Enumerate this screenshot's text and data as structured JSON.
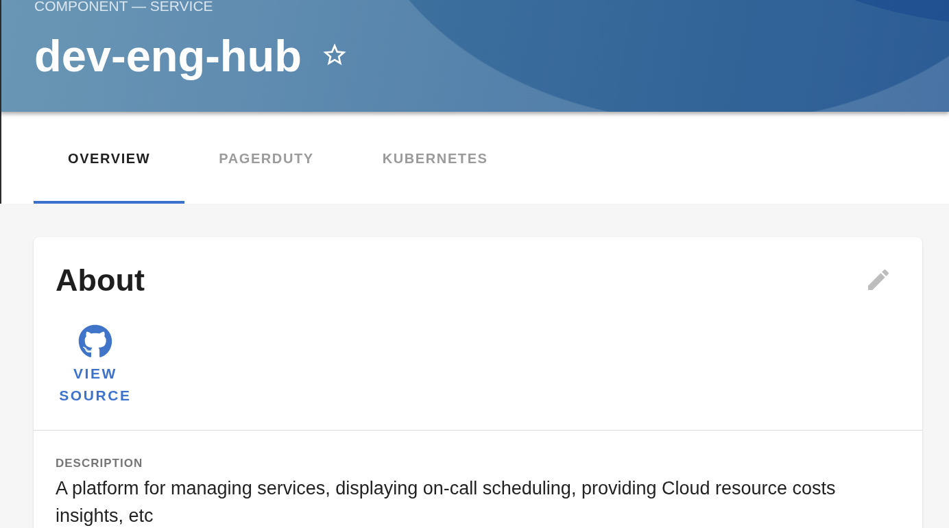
{
  "header": {
    "kind_label": "COMPONENT — SERVICE",
    "title": "dev-eng-hub",
    "starred": false
  },
  "tabs": [
    {
      "label": "OVERVIEW",
      "selected": true
    },
    {
      "label": "PAGERDUTY",
      "selected": false
    },
    {
      "label": "KUBERNETES",
      "selected": false
    }
  ],
  "about_card": {
    "title": "About",
    "links": [
      {
        "kind": "source",
        "label": "VIEW SOURCE"
      }
    ],
    "description_label": "DESCRIPTION",
    "description": "A platform for managing services, displaying on-call scheduling, providing Cloud resource costs insights, etc"
  }
}
